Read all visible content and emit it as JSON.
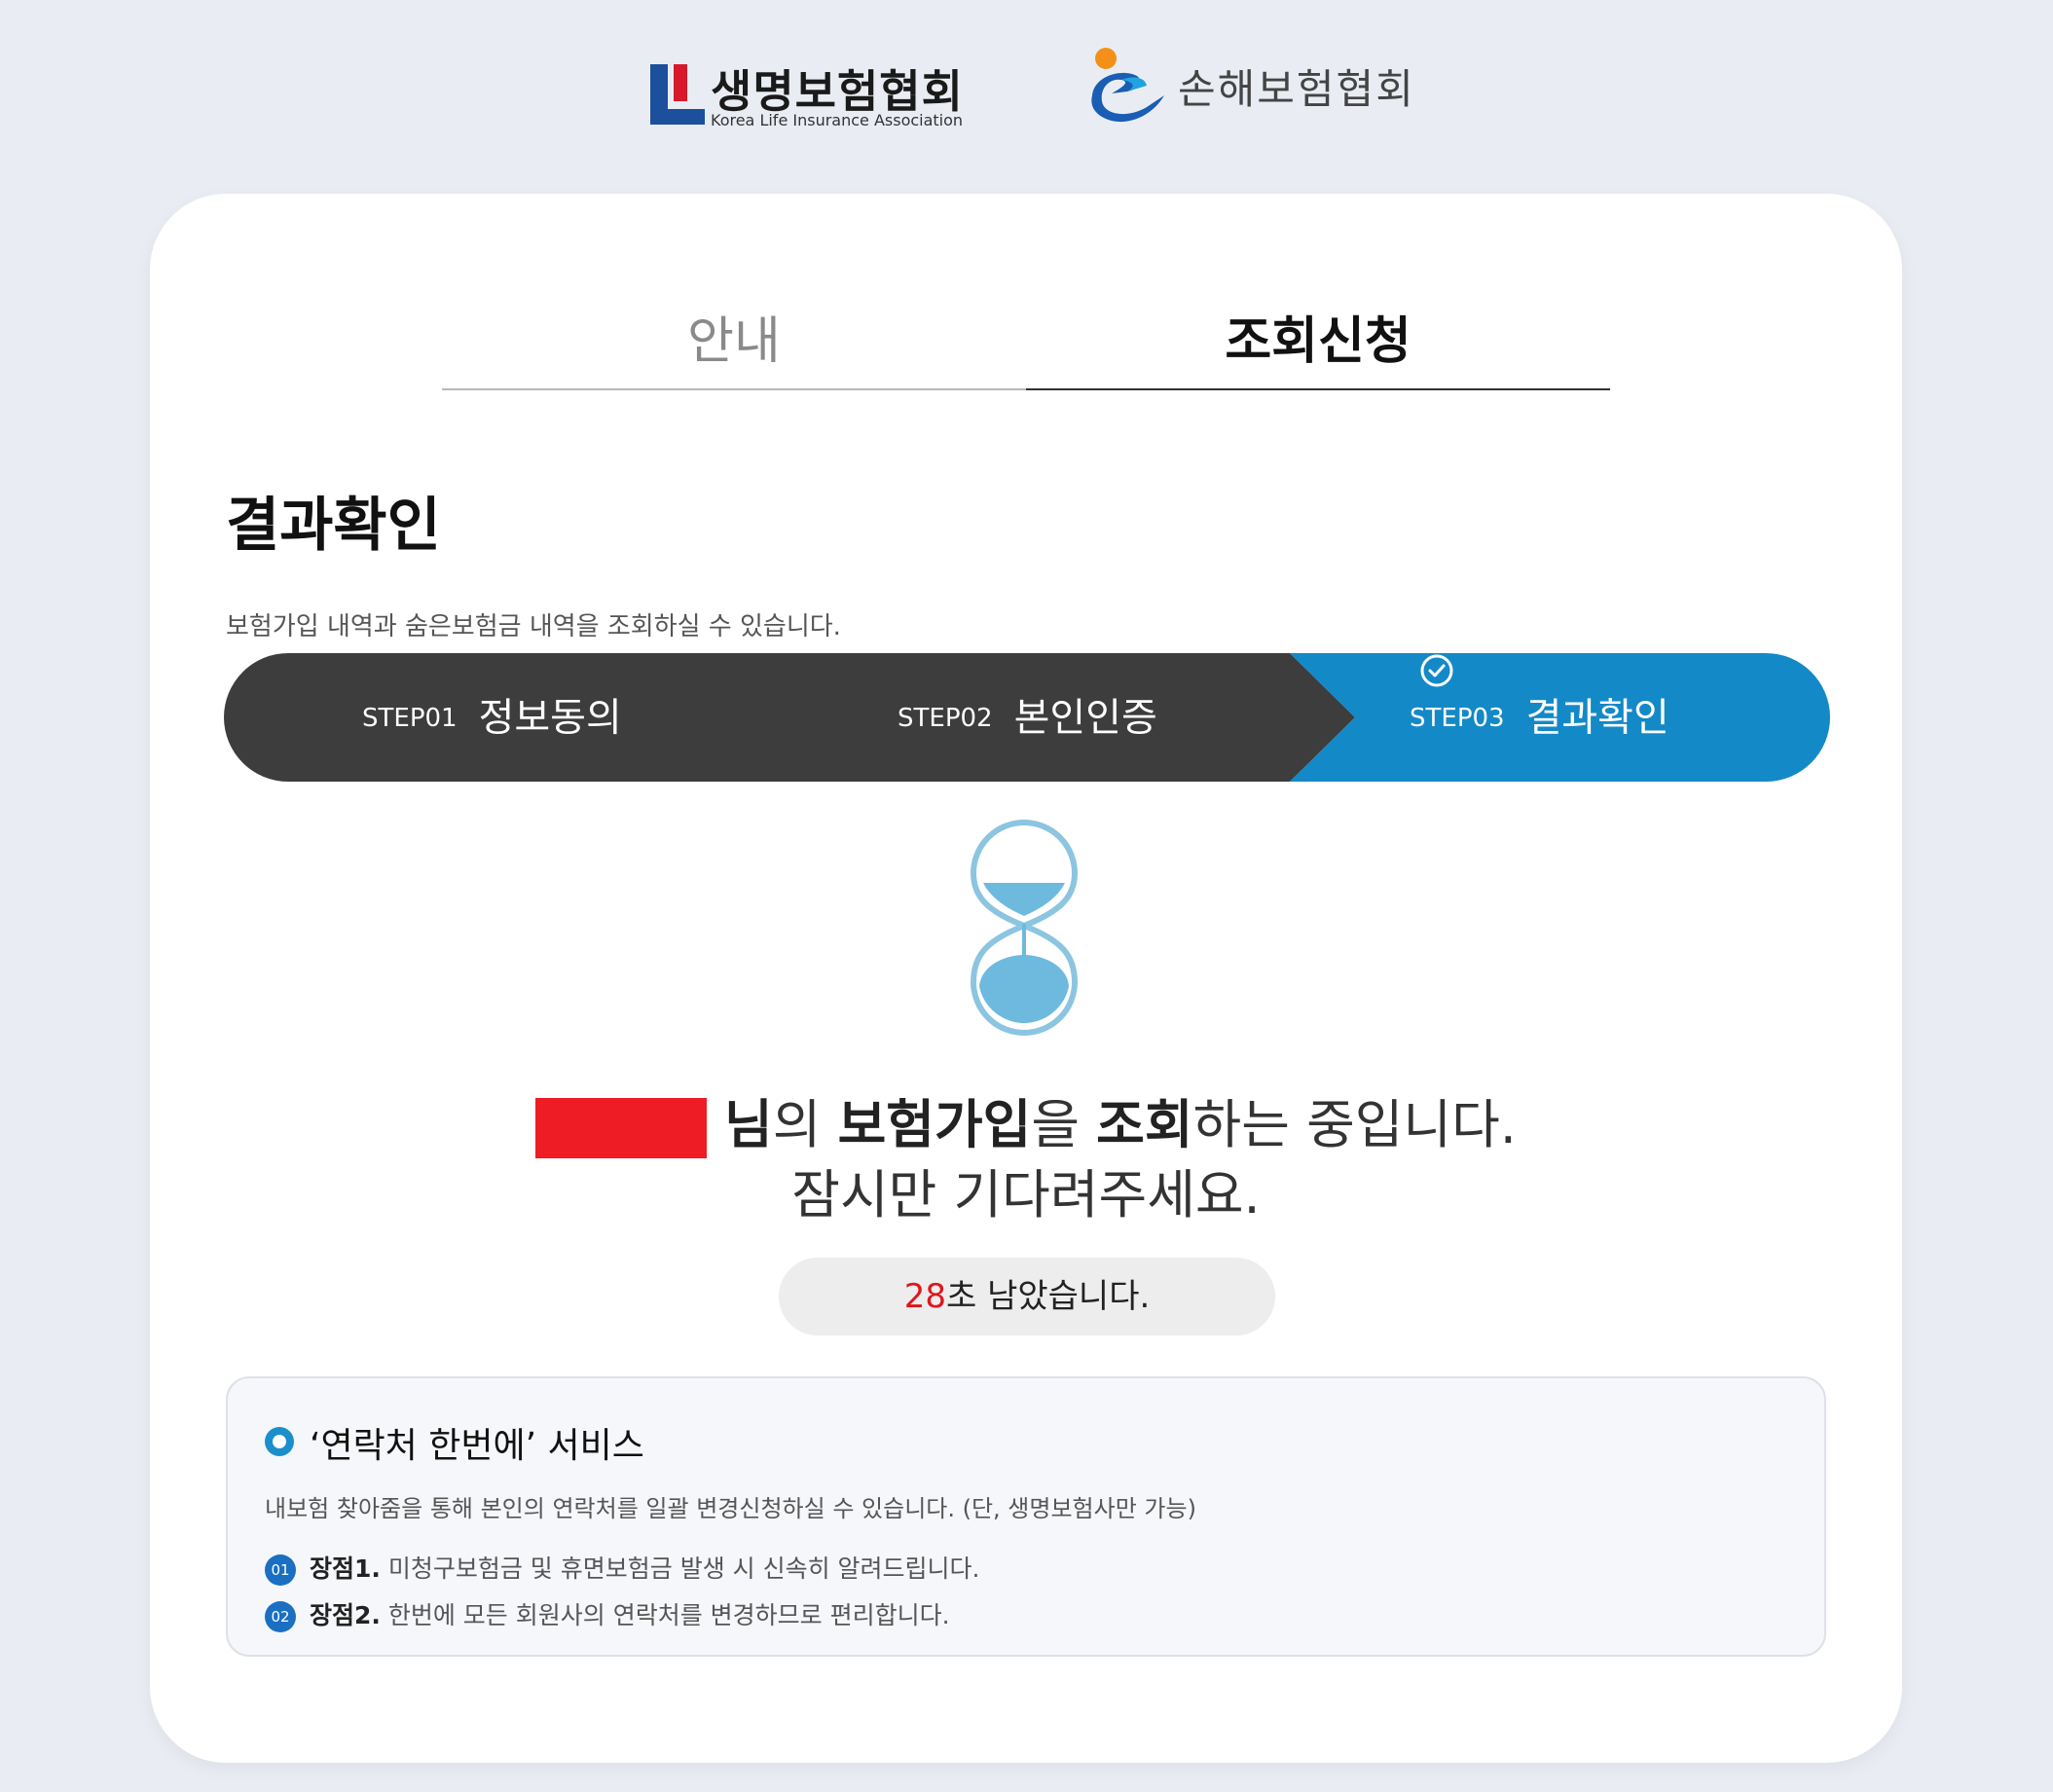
{
  "logos": {
    "life": {
      "name": "생명보험협회",
      "english": "Korea Life Insurance Association"
    },
    "general": {
      "name": "손해보험협회"
    }
  },
  "tabs": [
    {
      "label": "안내",
      "active": false
    },
    {
      "label": "조회신청",
      "active": true
    }
  ],
  "page": {
    "title": "결과확인",
    "description": "보험가입 내역과 숨은보험금 내역을 조회하실 수 있습니다."
  },
  "steps": [
    {
      "number": "STEP01",
      "label": "정보동의",
      "state": "done"
    },
    {
      "number": "STEP02",
      "label": "본인인증",
      "state": "done"
    },
    {
      "number": "STEP03",
      "label": "결과확인",
      "state": "current"
    }
  ],
  "colors": {
    "step_dark": "#3d3d3d",
    "step_active": "#1489c7",
    "redaction": "#ee1c25",
    "accent_red": "#e0151d"
  },
  "loading": {
    "suffix_nim": "님",
    "part_ui": "의 ",
    "part_bold1": "보험가입",
    "part_eul": "을 ",
    "part_bold2": "조회",
    "part_end": "하는 중입니다.",
    "line2": "잠시만 기다려주세요.",
    "icon": "hourglass-icon"
  },
  "timer": {
    "seconds": "28",
    "text": "초 남았습니다."
  },
  "service": {
    "title": "‘연락처 한번에’ 서비스",
    "description": "내보험 찾아줌을 통해 본인의 연락처를 일괄 변경신청하실 수 있습니다. (단, 생명보험사만 가능)",
    "items": [
      {
        "num": "01",
        "lead": "장점1.",
        "text": " 미청구보험금 및 휴면보험금 발생 시 신속히 알려드립니다."
      },
      {
        "num": "02",
        "lead": "장점2.",
        "text": " 한번에 모든 회원사의 연락처를 변경하므로 편리합니다."
      }
    ]
  }
}
